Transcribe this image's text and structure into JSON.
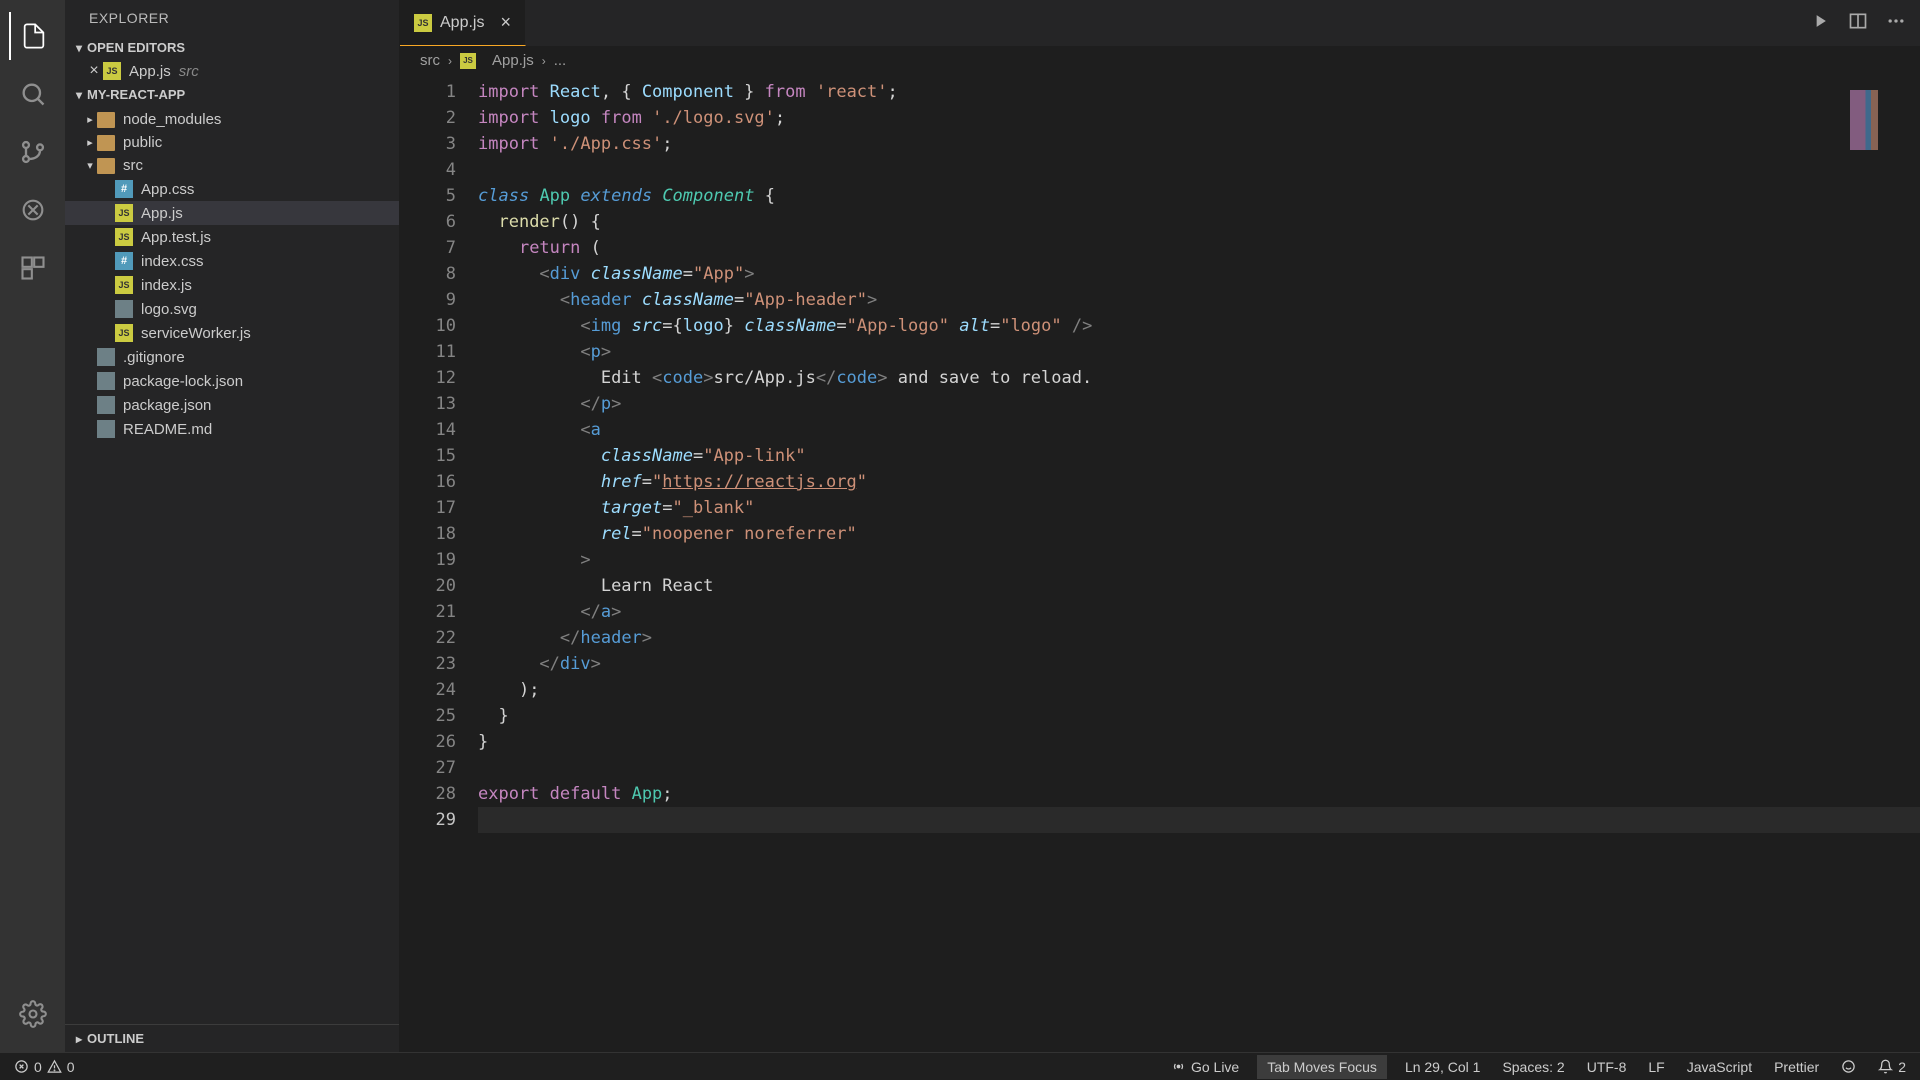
{
  "sidebar": {
    "title": "EXPLORER",
    "sections": {
      "open_editors": {
        "label": "OPEN EDITORS",
        "items": [
          {
            "name": "App.js",
            "dir": "src"
          }
        ]
      },
      "project": {
        "label": "MY-REACT-APP"
      },
      "outline": {
        "label": "OUTLINE"
      }
    },
    "tree": [
      {
        "type": "folder",
        "name": "node_modules",
        "expanded": false,
        "depth": 0
      },
      {
        "type": "folder",
        "name": "public",
        "expanded": false,
        "depth": 0
      },
      {
        "type": "folder",
        "name": "src",
        "expanded": true,
        "depth": 0
      },
      {
        "type": "file",
        "name": "App.css",
        "icon": "css",
        "depth": 1
      },
      {
        "type": "file",
        "name": "App.js",
        "icon": "js",
        "depth": 1,
        "selected": true
      },
      {
        "type": "file",
        "name": "App.test.js",
        "icon": "js",
        "depth": 1
      },
      {
        "type": "file",
        "name": "index.css",
        "icon": "css",
        "depth": 1
      },
      {
        "type": "file",
        "name": "index.js",
        "icon": "js",
        "depth": 1
      },
      {
        "type": "file",
        "name": "logo.svg",
        "icon": "svg",
        "depth": 1
      },
      {
        "type": "file",
        "name": "serviceWorker.js",
        "icon": "js",
        "depth": 1
      },
      {
        "type": "file",
        "name": ".gitignore",
        "icon": "git",
        "depth": 0
      },
      {
        "type": "file",
        "name": "package-lock.json",
        "icon": "json",
        "depth": 0
      },
      {
        "type": "file",
        "name": "package.json",
        "icon": "json",
        "depth": 0
      },
      {
        "type": "file",
        "name": "README.md",
        "icon": "md",
        "depth": 0
      }
    ]
  },
  "tabs": {
    "active": {
      "name": "App.js"
    }
  },
  "breadcrumb": {
    "parts": [
      "src",
      "App.js",
      "..."
    ]
  },
  "status": {
    "errors": "0",
    "warnings": "0",
    "go_live": "Go Live",
    "tab_focus": "Tab Moves Focus",
    "cursor": "Ln 29, Col 1",
    "spaces": "Spaces: 2",
    "encoding": "UTF-8",
    "eol": "LF",
    "language": "JavaScript",
    "prettier": "Prettier",
    "bell": "2"
  },
  "code": {
    "lines": [
      {
        "n": 1,
        "html": "<span class='kw'>import</span> <span class='var'>React</span><span class='white'>, { </span><span class='var'>Component</span><span class='white'> } </span><span class='kw'>from</span> <span class='str'>'react'</span><span class='white'>;</span>"
      },
      {
        "n": 2,
        "html": "<span class='kw'>import</span> <span class='var'>logo</span> <span class='kw'>from</span> <span class='str'>'./logo.svg'</span><span class='white'>;</span>"
      },
      {
        "n": 3,
        "html": "<span class='kw'>import</span> <span class='str'>'./App.css'</span><span class='white'>;</span>"
      },
      {
        "n": 4,
        "html": ""
      },
      {
        "n": 5,
        "html": "<span class='kw2'>class</span> <span class='cls'>App</span> <span class='kw2'>extends</span> <span class='cls' style='font-style:italic'>Component</span> <span class='white'>{</span>"
      },
      {
        "n": 6,
        "html": "  <span class='fn'>render</span><span class='white'>() {</span>"
      },
      {
        "n": 7,
        "html": "    <span class='kw'>return</span> <span class='white'>(</span>"
      },
      {
        "n": 8,
        "html": "      <span class='punct'>&lt;</span><span class='tag'>div</span> <span class='attr'>className</span><span class='white'>=</span><span class='str'>\"App\"</span><span class='punct'>&gt;</span>"
      },
      {
        "n": 9,
        "html": "        <span class='punct'>&lt;</span><span class='tag'>header</span> <span class='attr'>className</span><span class='white'>=</span><span class='str'>\"App-header\"</span><span class='punct'>&gt;</span>"
      },
      {
        "n": 10,
        "html": "          <span class='punct'>&lt;</span><span class='tag'>img</span> <span class='attr'>src</span><span class='white'>=</span><span class='white'>{</span><span class='var'>logo</span><span class='white'>}</span> <span class='attr'>className</span><span class='white'>=</span><span class='str'>\"App-logo\"</span> <span class='attr'>alt</span><span class='white'>=</span><span class='str'>\"logo\"</span> <span class='punct'>/&gt;</span>"
      },
      {
        "n": 11,
        "html": "          <span class='punct'>&lt;</span><span class='tag'>p</span><span class='punct'>&gt;</span>"
      },
      {
        "n": 12,
        "html": "            <span class='white'>Edit </span><span class='punct'>&lt;</span><span class='tag'>code</span><span class='punct'>&gt;</span><span class='white'>src/App.js</span><span class='punct'>&lt;/</span><span class='tag'>code</span><span class='punct'>&gt;</span><span class='white'> and save to reload.</span>"
      },
      {
        "n": 13,
        "html": "          <span class='punct'>&lt;/</span><span class='tag'>p</span><span class='punct'>&gt;</span>"
      },
      {
        "n": 14,
        "html": "          <span class='punct'>&lt;</span><span class='tag'>a</span>"
      },
      {
        "n": 15,
        "html": "            <span class='attr'>className</span><span class='white'>=</span><span class='str'>\"App-link\"</span>"
      },
      {
        "n": 16,
        "html": "            <span class='attr'>href</span><span class='white'>=</span><span class='str'>\"</span><span class='link'>https://reactjs.org</span><span class='str'>\"</span>"
      },
      {
        "n": 17,
        "html": "            <span class='attr'>target</span><span class='white'>=</span><span class='str'>\"_blank\"</span>"
      },
      {
        "n": 18,
        "html": "            <span class='attr'>rel</span><span class='white'>=</span><span class='str'>\"noopener noreferrer\"</span>"
      },
      {
        "n": 19,
        "html": "          <span class='punct'>&gt;</span>"
      },
      {
        "n": 20,
        "html": "            <span class='white'>Learn React</span>"
      },
      {
        "n": 21,
        "html": "          <span class='punct'>&lt;/</span><span class='tag'>a</span><span class='punct'>&gt;</span>"
      },
      {
        "n": 22,
        "html": "        <span class='punct'>&lt;/</span><span class='tag'>header</span><span class='punct'>&gt;</span>"
      },
      {
        "n": 23,
        "html": "      <span class='punct'>&lt;/</span><span class='tag'>div</span><span class='punct'>&gt;</span>"
      },
      {
        "n": 24,
        "html": "    <span class='white'>);</span>"
      },
      {
        "n": 25,
        "html": "  <span class='white'>}</span>"
      },
      {
        "n": 26,
        "html": "<span class='white'>}</span>"
      },
      {
        "n": 27,
        "html": ""
      },
      {
        "n": 28,
        "html": "<span class='kw'>export</span> <span class='kw'>default</span> <span class='cls'>App</span><span class='white'>;</span>"
      },
      {
        "n": 29,
        "html": "",
        "active": true
      }
    ]
  }
}
